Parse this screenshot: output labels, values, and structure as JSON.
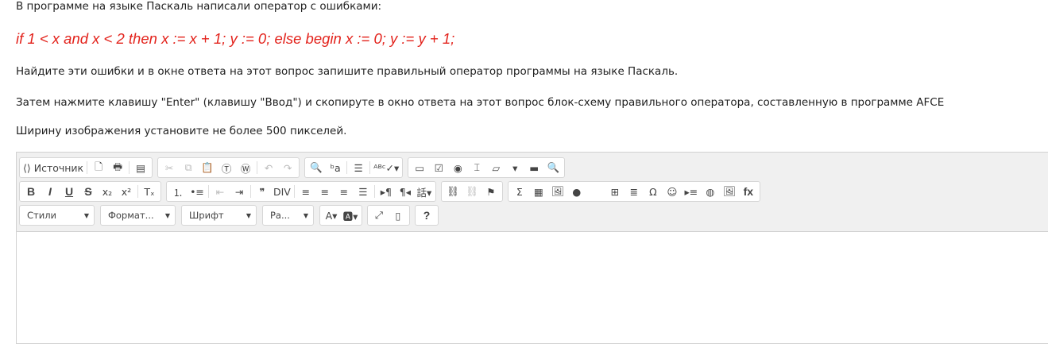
{
  "text": {
    "intro": "В программе на языке Паскаль написали оператор с ошибками:",
    "code": "if 1 < x  and x < 2 then  x := x + 1; y := 0; else begin x := 0; y := y + 1;",
    "task1": "Найдите эти ошибки и в окне ответа на этот вопрос запишите правильный оператор программы на языке Паскаль.",
    "task2": "Затем нажмите клавишу \"Enter\" (клавишу \"Ввод\") и скопируте в окно ответа на этот вопрос блок-схему правильного оператора, составленную в программе AFCE",
    "task3": "Ширину изображения установите не более 500 пикселей."
  },
  "colors": {
    "code": "#e3231c",
    "toolbar_bg": "#f0f0f0"
  },
  "toolbar": {
    "rows": [
      [
        [
          {
            "n": "source",
            "g": "⟨⟩ Источник"
          },
          "|",
          {
            "n": "new-page",
            "g": "🗋"
          },
          {
            "n": "print",
            "g": "🖶"
          },
          "|",
          {
            "n": "templates",
            "g": "▤"
          }
        ],
        [
          {
            "n": "cut",
            "g": "✂",
            "d": 1
          },
          {
            "n": "copy",
            "g": "⧉",
            "d": 1
          },
          {
            "n": "paste",
            "g": "📋"
          },
          {
            "n": "paste-text",
            "g": "Ⓣ"
          },
          {
            "n": "paste-word",
            "g": "Ⓦ"
          },
          "|",
          {
            "n": "undo",
            "g": "↶",
            "d": 1
          },
          {
            "n": "redo",
            "g": "↷",
            "d": 1
          }
        ],
        [
          {
            "n": "find",
            "g": "🔍"
          },
          {
            "n": "replace",
            "g": "ᵇa"
          },
          "|",
          {
            "n": "select-all",
            "g": "☰"
          },
          "|",
          {
            "n": "spellcheck",
            "g": "ᴬᴮᶜ✓▾"
          }
        ],
        [
          {
            "n": "form",
            "g": "▭"
          },
          {
            "n": "checkbox",
            "g": "☑"
          },
          {
            "n": "radio",
            "g": "◉"
          },
          {
            "n": "text-field",
            "g": "⌶"
          },
          {
            "n": "textarea",
            "g": "▱"
          },
          {
            "n": "select",
            "g": "▾"
          },
          {
            "n": "button",
            "g": "▬"
          },
          {
            "n": "image-button",
            "g": "🔍"
          }
        ]
      ],
      [
        [
          {
            "n": "bold",
            "g": "B",
            "b": 1
          },
          {
            "n": "italic",
            "g": "I",
            "b": 1
          },
          {
            "n": "underline",
            "g": "U",
            "b": 1
          },
          {
            "n": "strike",
            "g": "S",
            "b": 1
          },
          {
            "n": "subscript",
            "g": "x₂"
          },
          {
            "n": "superscript",
            "g": "x²"
          },
          "|",
          {
            "n": "remove-format",
            "g": "Tₓ"
          }
        ],
        [
          {
            "n": "numbered-list",
            "g": "⒈"
          },
          {
            "n": "bulleted-list",
            "g": "•≡"
          },
          "|",
          {
            "n": "outdent",
            "g": "⇤",
            "d": 1
          },
          {
            "n": "indent",
            "g": "⇥"
          },
          "|",
          {
            "n": "blockquote",
            "g": "❞"
          },
          {
            "n": "div",
            "g": "DIV"
          },
          "|",
          {
            "n": "align-left",
            "g": "≡"
          },
          {
            "n": "align-center",
            "g": "≡"
          },
          {
            "n": "align-right",
            "g": "≡"
          },
          {
            "n": "justify",
            "g": "☰"
          },
          "|",
          {
            "n": "ltr",
            "g": "▸¶"
          },
          {
            "n": "rtl",
            "g": "¶◂"
          },
          {
            "n": "language",
            "g": "話▾"
          }
        ],
        [
          {
            "n": "link",
            "g": "⛓"
          },
          {
            "n": "unlink",
            "g": "⛓",
            "d": 1
          },
          {
            "n": "anchor",
            "g": "⚑"
          }
        ],
        [
          {
            "n": "math",
            "g": "Σ"
          },
          {
            "n": "media",
            "g": "▦"
          },
          {
            "n": "image",
            "g": "🖼"
          },
          {
            "n": "flash",
            "g": "●"
          },
          "gap",
          {
            "n": "table",
            "g": "⊞"
          },
          {
            "n": "horizontal-line",
            "g": "≣"
          },
          {
            "n": "special-char",
            "g": "Ω"
          },
          {
            "n": "smiley",
            "g": "☺"
          },
          {
            "n": "page-break",
            "g": "▸≡"
          },
          {
            "n": "iframe",
            "g": "◍"
          },
          {
            "n": "image2",
            "g": "🖼"
          },
          {
            "n": "formula",
            "g": "fx",
            "b": 1
          }
        ]
      ]
    ],
    "combos": [
      {
        "n": "styles",
        "label": "Стили",
        "w": 78
      },
      {
        "n": "format",
        "label": "Формат...",
        "w": 78
      },
      {
        "n": "font",
        "label": "Шрифт",
        "w": 78
      },
      {
        "n": "size",
        "label": "Ра...",
        "w": 48
      }
    ],
    "row3_groups": [
      [
        {
          "n": "text-color",
          "g": "A▾"
        },
        {
          "n": "bg-color",
          "g": "🅰▾"
        }
      ],
      [
        {
          "n": "maximize",
          "g": "⤢"
        },
        {
          "n": "show-blocks",
          "g": "▯"
        }
      ],
      [
        {
          "n": "help",
          "g": "?",
          "b": 1
        }
      ]
    ]
  }
}
